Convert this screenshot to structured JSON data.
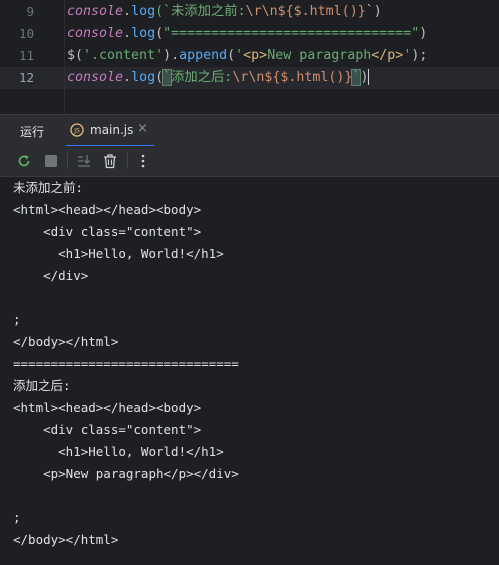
{
  "editor": {
    "line_numbers": [
      "9",
      "10",
      "11",
      "12"
    ],
    "lines": [
      {
        "obj": "console",
        "dot": ".",
        "fn": "log",
        "open": "(`",
        "str1": "未添加之前:",
        "esc": "\\r\\n",
        "interp": "${$.html()}",
        "close": "`)",
        "tail": ""
      },
      {
        "obj": "console",
        "dot": ".",
        "fn": "log",
        "open": "(",
        "str": "\"==============================\"",
        "close": ")"
      },
      {
        "dollar": "$(",
        "sel": "'.content'",
        "mid": ").",
        "fn": "append",
        "open": "(",
        "q1": "'",
        "tag1": "<p>",
        "text": "New paragraph",
        "tag2": "</p>",
        "q2": "'",
        "close": ");"
      },
      {
        "obj": "console",
        "dot": ".",
        "fn": "log",
        "open": "(",
        "bq1": "`",
        "str1": "添加之后:",
        "esc": "\\r\\n",
        "interp": "${$.html()}",
        "bq2": "`",
        "close": ")"
      }
    ]
  },
  "panel": {
    "title": "运行",
    "tab_label": "main.js",
    "tab_close": "×"
  },
  "toolbar": {
    "buttons": [
      "rerun-icon",
      "stop-icon",
      "scroll-to-end-icon",
      "trash-icon",
      "more-icon"
    ]
  },
  "console_output": [
    "未添加之前:",
    "<html><head></head><body>",
    "    <div class=\"content\">",
    "      <h1>Hello, World!</h1>",
    "    </div>",
    "",
    ";",
    "</body></html>",
    "==============================",
    "添加之后:",
    "<html><head></head><body>",
    "    <div class=\"content\">",
    "      <h1>Hello, World!</h1>",
    "    <p>New paragraph</p></div>",
    "",
    ";",
    "</body></html>"
  ],
  "colors": {
    "background": "#1e1f22",
    "panel": "#2b2d30",
    "accent": "#3574f0",
    "keyword_object": "#c77dbb",
    "function": "#57aaf7",
    "string": "#6aab73",
    "escape": "#cf8e6d"
  }
}
